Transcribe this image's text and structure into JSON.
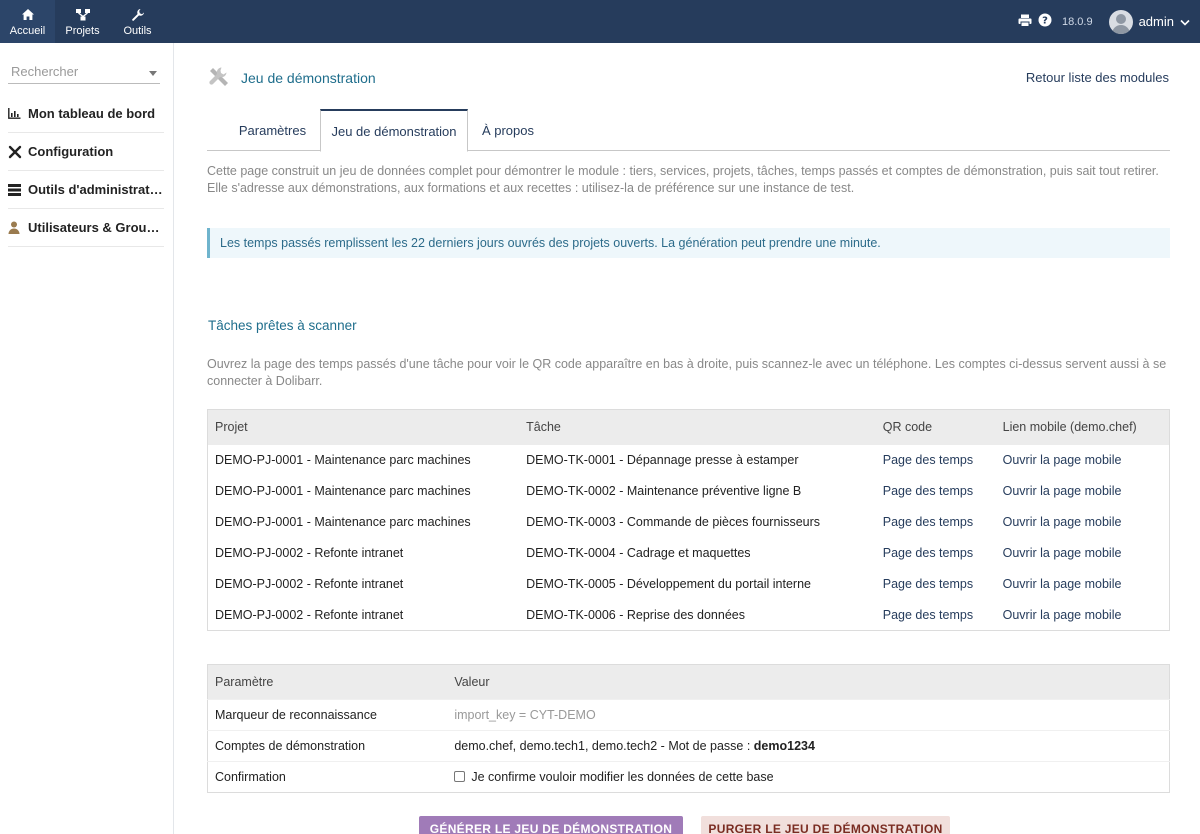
{
  "topbar": {
    "nav": [
      {
        "label": "Accueil",
        "icon": "home-icon"
      },
      {
        "label": "Projets",
        "icon": "projects-icon"
      },
      {
        "label": "Outils",
        "icon": "wrench-icon"
      }
    ],
    "version": "18.0.9",
    "user": "admin"
  },
  "sidebar": {
    "search_placeholder": "Rechercher",
    "items": [
      {
        "label": "Mon tableau de bord",
        "icon": "chart-icon"
      },
      {
        "label": "Configuration",
        "icon": "tools-icon"
      },
      {
        "label": "Outils d'administration",
        "icon": "server-icon"
      },
      {
        "label": "Utilisateurs & Groupes",
        "icon": "user-icon"
      }
    ]
  },
  "header": {
    "title": "Jeu de démonstration",
    "back_link": "Retour liste des modules"
  },
  "tabs": [
    {
      "label": "Paramètres"
    },
    {
      "label": "Jeu de démonstration"
    },
    {
      "label": "À propos"
    }
  ],
  "intro": "Cette page construit un jeu de données complet pour démontrer le module : tiers, services, projets, tâches, temps passés et comptes de démonstration, puis sait tout retirer. Elle s'adresse aux démonstrations, aux formations et aux recettes : utilisez-la de préférence sur une instance de test.",
  "info": "Les temps passés remplissent les 22 derniers jours ouvrés des projets ouverts. La génération peut prendre une minute.",
  "tasks_section": {
    "title": "Tâches prêtes à scanner",
    "description": "Ouvrez la page des temps passés d'une tâche pour voir le QR code apparaître en bas à droite, puis scannez-le avec un téléphone. Les comptes ci-dessus servent aussi à se connecter à Dolibarr.",
    "columns": [
      "Projet",
      "Tâche",
      "QR code",
      "Lien mobile (demo.chef)"
    ],
    "rows": [
      {
        "project": "DEMO-PJ-0001 - Maintenance parc machines",
        "task": "DEMO-TK-0001 - Dépannage presse à estamper",
        "qr": "Page des temps",
        "mobile": "Ouvrir la page mobile"
      },
      {
        "project": "DEMO-PJ-0001 - Maintenance parc machines",
        "task": "DEMO-TK-0002 - Maintenance préventive ligne B",
        "qr": "Page des temps",
        "mobile": "Ouvrir la page mobile"
      },
      {
        "project": "DEMO-PJ-0001 - Maintenance parc machines",
        "task": "DEMO-TK-0003 - Commande de pièces fournisseurs",
        "qr": "Page des temps",
        "mobile": "Ouvrir la page mobile"
      },
      {
        "project": "DEMO-PJ-0002 - Refonte intranet",
        "task": "DEMO-TK-0004 - Cadrage et maquettes",
        "qr": "Page des temps",
        "mobile": "Ouvrir la page mobile"
      },
      {
        "project": "DEMO-PJ-0002 - Refonte intranet",
        "task": "DEMO-TK-0005 - Développement du portail interne",
        "qr": "Page des temps",
        "mobile": "Ouvrir la page mobile"
      },
      {
        "project": "DEMO-PJ-0002 - Refonte intranet",
        "task": "DEMO-TK-0006 - Reprise des données",
        "qr": "Page des temps",
        "mobile": "Ouvrir la page mobile"
      }
    ]
  },
  "params": {
    "columns": [
      "Paramètre",
      "Valeur"
    ],
    "marker_label": "Marqueur de reconnaissance",
    "marker_value": "import_key = CYT-DEMO",
    "accounts_label": "Comptes de démonstration",
    "accounts_value": "demo.chef, demo.tech1, demo.tech2 - Mot de passe : ",
    "accounts_password": "demo1234",
    "confirm_label": "Confirmation",
    "confirm_text": "Je confirme vouloir modifier les données de cette base"
  },
  "buttons": {
    "generate": "GÉNÉRER LE JEU DE DÉMONSTRATION",
    "purge": "PURGER LE JEU DE DÉMONSTRATION"
  },
  "colors": {
    "topbar": "#263c5c",
    "accent_title": "#1f6e8c",
    "generate_button": "#a07bb8",
    "purge_button": "#f1dfdc"
  }
}
